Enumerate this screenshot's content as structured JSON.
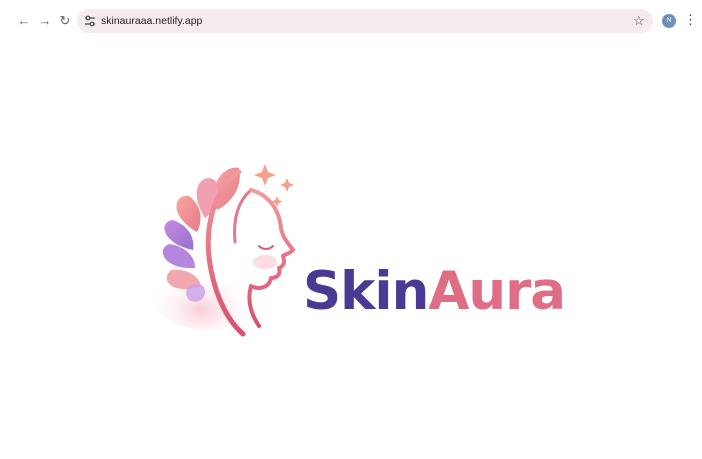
{
  "browser": {
    "url": "skinauraaa.netlify.app",
    "avatar_initial": "N",
    "icons": [
      "back-arrow-icon",
      "forward-arrow-icon",
      "reload-icon",
      "site-settings-icon",
      "bookmark-star-icon",
      "menu-dots-icon"
    ]
  },
  "page": {
    "brand_part1": "Skin",
    "brand_part2": "Aura",
    "colors": {
      "brand_dark": "#4a3a93",
      "brand_pink": "#e06d86",
      "omnibox_bg": "#f6ecef"
    }
  }
}
